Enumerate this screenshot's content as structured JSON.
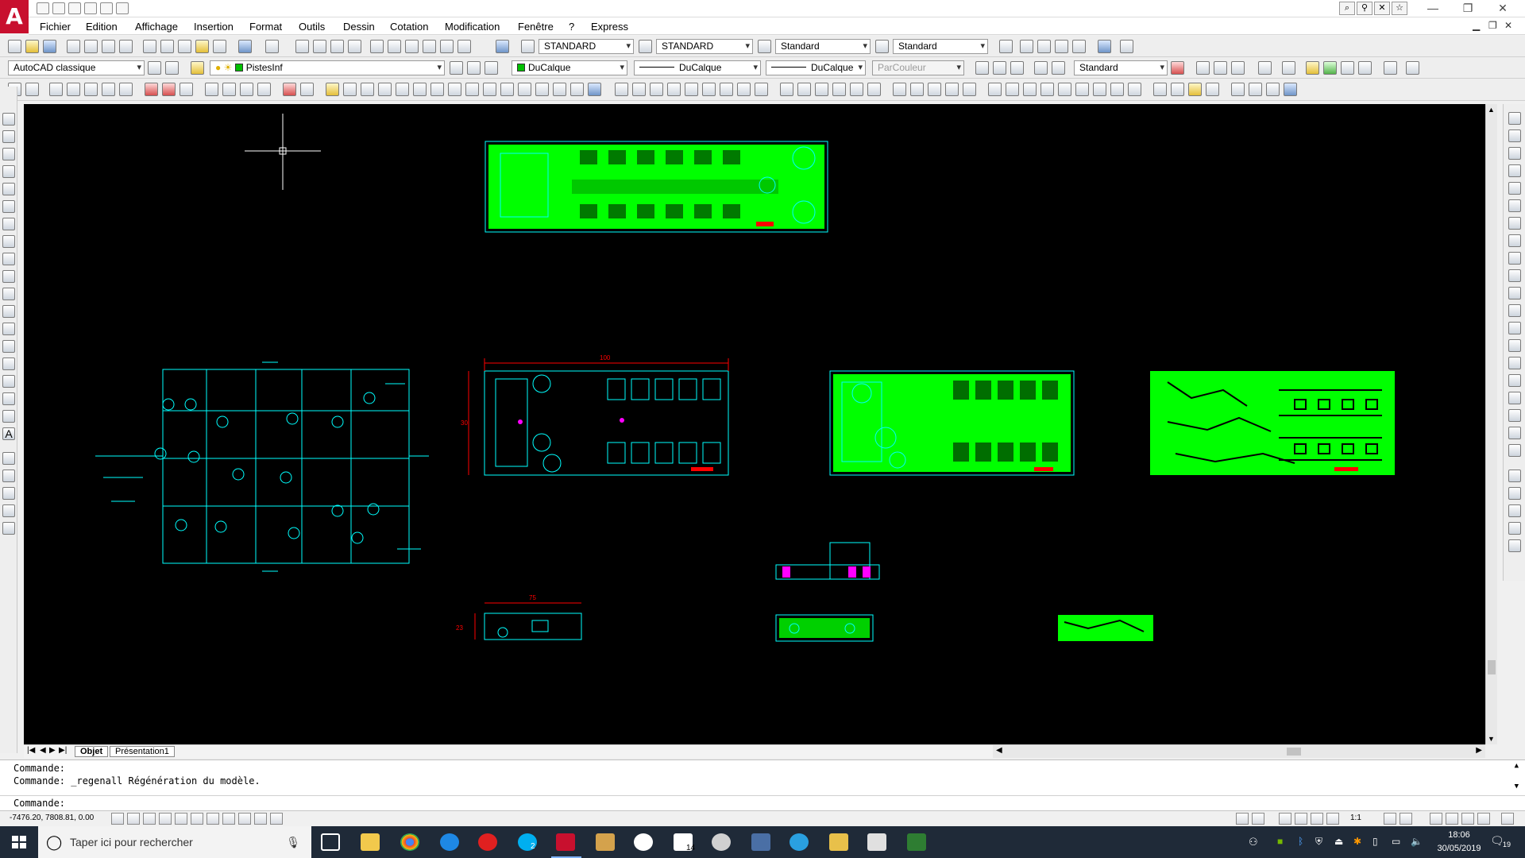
{
  "menubar": {
    "items": [
      "Fichier",
      "Edition",
      "Affichage",
      "Insertion",
      "Format",
      "Outils",
      "Dessin",
      "Cotation",
      "Modification",
      "Fenêtre",
      "?",
      "Express"
    ]
  },
  "toolbar_styles": {
    "text_style": "STANDARD",
    "dim_style": "STANDARD",
    "table_style": "Standard",
    "multileader_style": "Standard"
  },
  "toolbar_layers": {
    "workspace": "AutoCAD classique",
    "layer": "PistesInf",
    "color": "DuCalque",
    "linetype": "DuCalque",
    "lineweight": "DuCalque",
    "plotstyle": "ParCouleur",
    "visual_style": "Standard"
  },
  "drawing": {
    "dim_1": "100",
    "dim_2": "30",
    "dim_3": "75",
    "dim_4": "23"
  },
  "layout_tabs": [
    "Objet",
    "Présentation1"
  ],
  "command": {
    "line1": "Commande:",
    "line2": "Commande: _regenall Régénération du modèle.",
    "prompt": "Commande:"
  },
  "status": {
    "coordinates": "-7476.20, 7808.81, 0.00",
    "annotation_scale": "1:1"
  },
  "taskbar": {
    "search_placeholder": "Taper ici pour rechercher",
    "mail_badge": "14",
    "skype_badge": "2",
    "time": "18:06",
    "date": "30/05/2019",
    "notif_count": "19"
  },
  "colors": {
    "canvas_bg": "#000000",
    "pcb_green": "#00ff00",
    "outline_cyan": "#00ffff",
    "dim_red": "#ff0000",
    "pad_magenta": "#ff00ff",
    "logo_red": "#c8102e"
  }
}
